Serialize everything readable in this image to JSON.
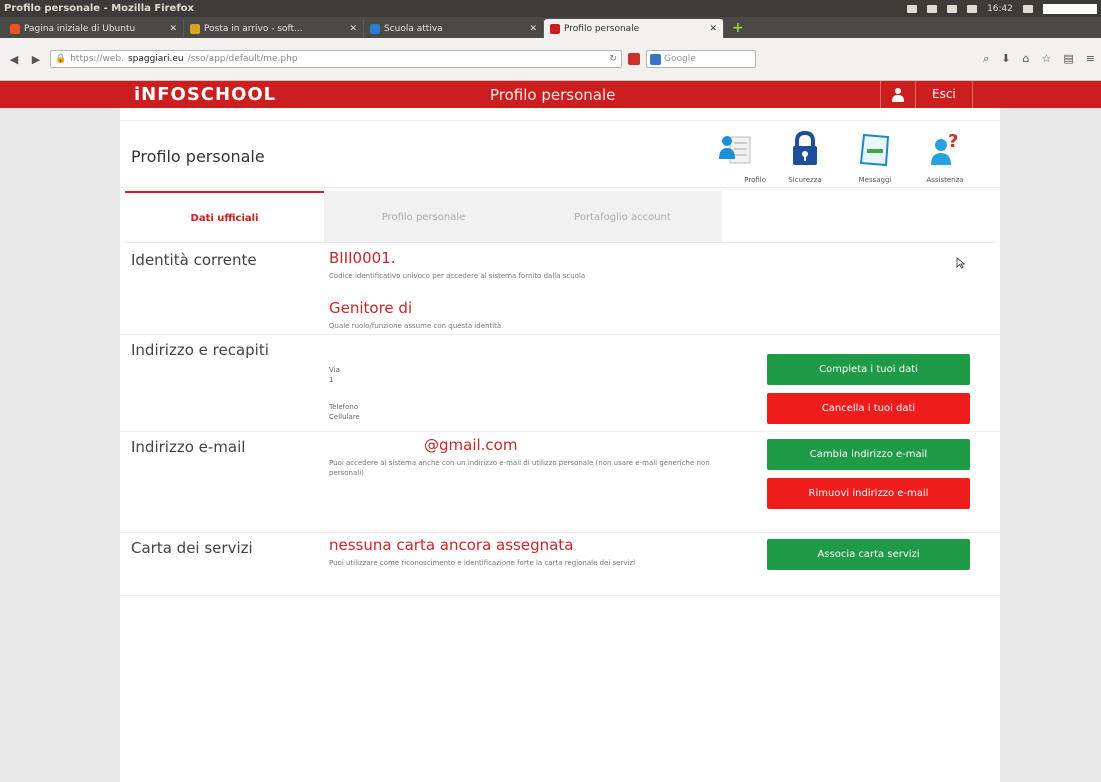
{
  "window": {
    "title": "Profilo personale - Mozilla Firefox",
    "clock": "16:42"
  },
  "tabs": [
    {
      "title": "Pagina iniziale di Ubuntu",
      "fav": "#e95420"
    },
    {
      "title": "Posta in arrivo - soft...",
      "fav": "#d8a520"
    },
    {
      "title": "Scuola attiva",
      "fav": "#2f7ad0"
    },
    {
      "title": "Profilo personale",
      "fav": "#cc1e1e"
    }
  ],
  "new_tab_label": "+",
  "nav": {
    "url_prefix": "https://web.",
    "url_host": "spaggiari.eu",
    "url_path": "/sso/app/default/me.php",
    "search_placeholder": "Google"
  },
  "header": {
    "brand": "iNFOSCHOOL",
    "title": "Profilo personale",
    "exit_label": "Esci"
  },
  "profile": {
    "title": "Profilo personale",
    "shortcuts": [
      {
        "label": "Profilo",
        "icon": "profile-card-icon"
      },
      {
        "label": "Sicurezza",
        "icon": "lock-icon"
      },
      {
        "label": "Messaggi",
        "icon": "message-icon"
      },
      {
        "label": "Assistenza",
        "icon": "help-icon"
      }
    ]
  },
  "tabs_profile": [
    "Dati ufficiali",
    "Profilo personale",
    "Portafoglio account"
  ],
  "sections": {
    "identita": {
      "label": "Identità corrente",
      "code": "BIII0001.",
      "code_hint": "Codice identificativo univoco per accedere al sistema fornito dalla scuola",
      "role": "Genitore di",
      "role_hint": "Quale ruolo/funzione assume con questa identità"
    },
    "indirizzo": {
      "label": "Indirizzo e recapiti",
      "line1": "Via",
      "line2": "1",
      "phone": "Telefono",
      "mobile": "Cellulare",
      "btn_complete": "Completa i tuoi dati",
      "btn_delete": "Cancella i tuoi dati"
    },
    "email": {
      "label": "Indirizzo e-mail",
      "value": "@gmail.com",
      "hint": "Puoi accedere al sistema anche con un indirizzo e-mail di utilizzo personale (non usare e-mail generiche non personali)",
      "btn_change": "Cambia indirizzo e-mail",
      "btn_remove": "Rimuovi indirizzo e-mail"
    },
    "carta": {
      "label": "Carta dei servizi",
      "value": "nessuna carta ancora assegnata",
      "hint": "Puoi utilizzare come riconoscimento e identificazione forte la carta regionale dei servizi",
      "btn_assoc": "Associa carta servizi"
    }
  }
}
